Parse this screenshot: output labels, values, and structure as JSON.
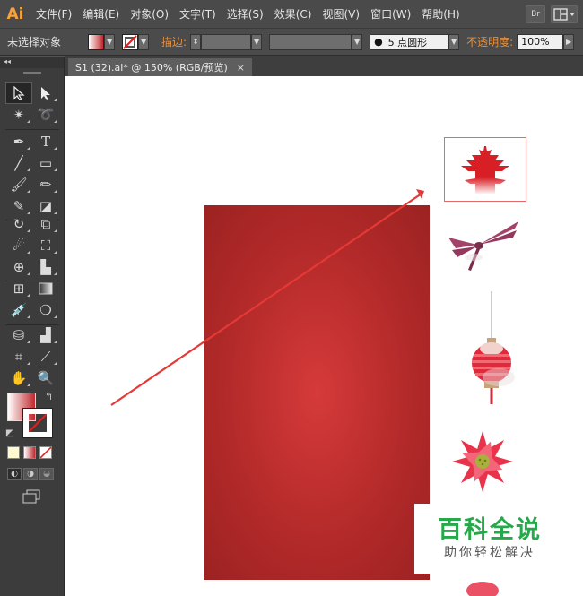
{
  "app": {
    "logo": "Ai"
  },
  "menu": [
    "文件(F)",
    "编辑(E)",
    "对象(O)",
    "文字(T)",
    "选择(S)",
    "效果(C)",
    "视图(V)",
    "窗口(W)",
    "帮助(H)"
  ],
  "menubar_right": {
    "bridge_label": "Br"
  },
  "control": {
    "selection_status": "未选择对象",
    "stroke_label": "描边:",
    "brush_label": "5 点圆形",
    "opacity_label": "不透明度:",
    "opacity_value": "100%"
  },
  "document": {
    "tab_title": "S1 (32).ai* @ 150% (RGB/预览)",
    "close": "×"
  },
  "colors": {
    "accent_orange": "#e8903a",
    "canvas_red": "#b42a2a",
    "arrow_red": "#e53935",
    "watermark_green": "#27a84a"
  },
  "watermark": {
    "title": "百科全说",
    "subtitle": "助你轻松解决"
  }
}
